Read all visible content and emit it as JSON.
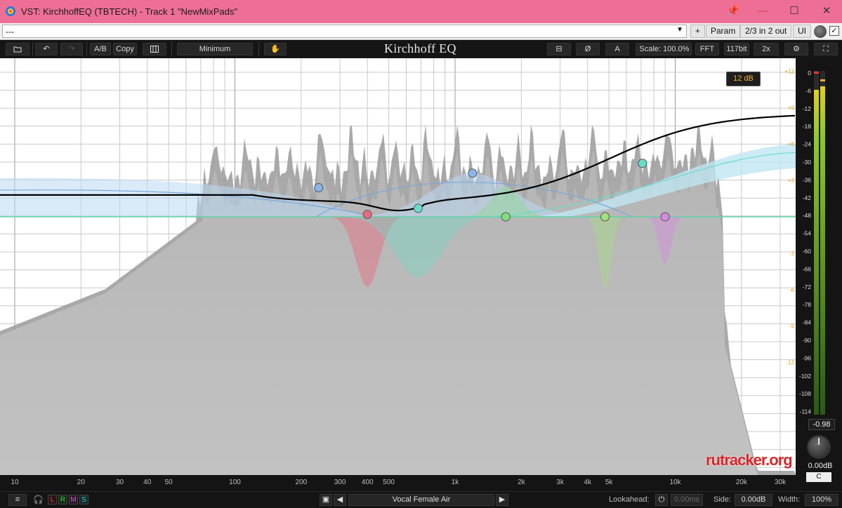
{
  "window": {
    "title": "VST: KirchhoffEQ (TBTECH) - Track 1 \"NewMixPads\"",
    "pin": "📌",
    "minimize": "—",
    "maximize": "☐",
    "close": "✕"
  },
  "host": {
    "preset": "---",
    "plus": "+",
    "param": "Param",
    "routing": "2/3 in 2 out",
    "ui": "UI"
  },
  "toolbar": {
    "ab": "A/B",
    "copy": "Copy",
    "phase_mode": "Minimum",
    "brand": "Kirchhoff EQ",
    "channel": "A",
    "scale_label": "Scale:",
    "scale_value": "100.0%",
    "fft": "FFT",
    "resolution": "117bit",
    "oversample": "2x"
  },
  "analyzer": {
    "range_tooltip": "12 dB",
    "freq_labels": [
      {
        "t": "10",
        "f": 10
      },
      {
        "t": "20",
        "f": 20
      },
      {
        "t": "30",
        "f": 30
      },
      {
        "t": "40",
        "f": 40
      },
      {
        "t": "50",
        "f": 50
      },
      {
        "t": "100",
        "f": 100
      },
      {
        "t": "200",
        "f": 200
      },
      {
        "t": "300",
        "f": 300
      },
      {
        "t": "400",
        "f": 400
      },
      {
        "t": "500",
        "f": 500
      },
      {
        "t": "1k",
        "f": 1000
      },
      {
        "t": "2k",
        "f": 2000
      },
      {
        "t": "3k",
        "f": 3000
      },
      {
        "t": "4k",
        "f": 4000
      },
      {
        "t": "5k",
        "f": 5000
      },
      {
        "t": "10k",
        "f": 10000
      },
      {
        "t": "20k",
        "f": 20000
      },
      {
        "t": "30k",
        "f": 30000
      }
    ],
    "gain_labels": [
      "+12",
      "+9",
      "+6",
      "+3",
      "-3",
      "-6",
      "-9",
      "-12"
    ],
    "db_labels": [
      "0",
      "-6",
      "-12",
      "-18",
      "-24",
      "-30",
      "-36",
      "-42",
      "-48",
      "-54",
      "-60",
      "-66",
      "-72",
      "-78",
      "-84",
      "-90",
      "-96",
      "-102",
      "-108",
      "-114"
    ],
    "nodes": [
      {
        "freq": 240,
        "gain": 2.4,
        "color": "#8bb4e8",
        "name": "band-node-low-shelf"
      },
      {
        "freq": 400,
        "gain": 0.2,
        "color": "#ea6a80",
        "name": "band-node-notch-400"
      },
      {
        "freq": 680,
        "gain": 0.7,
        "color": "#67ddc8",
        "name": "band-node-680"
      },
      {
        "freq": 1200,
        "gain": 3.6,
        "color": "#8bb4e8",
        "name": "band-node-bell-1k"
      },
      {
        "freq": 1700,
        "gain": 0.0,
        "color": "#7ee07c",
        "name": "band-node-1k7"
      },
      {
        "freq": 4800,
        "gain": 0.0,
        "color": "#a6e07c",
        "name": "band-node-5k"
      },
      {
        "freq": 7100,
        "gain": 4.4,
        "color": "#67ddc8",
        "name": "band-node-high-shelf"
      },
      {
        "freq": 9000,
        "gain": 0.0,
        "color": "#d88ae0",
        "name": "band-node-9k"
      }
    ],
    "watermark": "rutracker.org"
  },
  "meter": {
    "peak_value": "-0.98",
    "gain_value": "0.00dB",
    "channel": "C"
  },
  "bottom": {
    "menu": "≡",
    "l": "L",
    "r": "R",
    "m": "M",
    "s": "S",
    "preset_name": "Vocal Female Air",
    "lookahead_label": "Lookahead:",
    "lookahead_value": "0.00ms",
    "side_label": "Side:",
    "side_value": "0.00dB",
    "width_label": "Width:",
    "width_value": "100%"
  },
  "colors": {
    "accent": "#f0b030",
    "titlebar": "#ee6f95",
    "curve": "#000000"
  }
}
